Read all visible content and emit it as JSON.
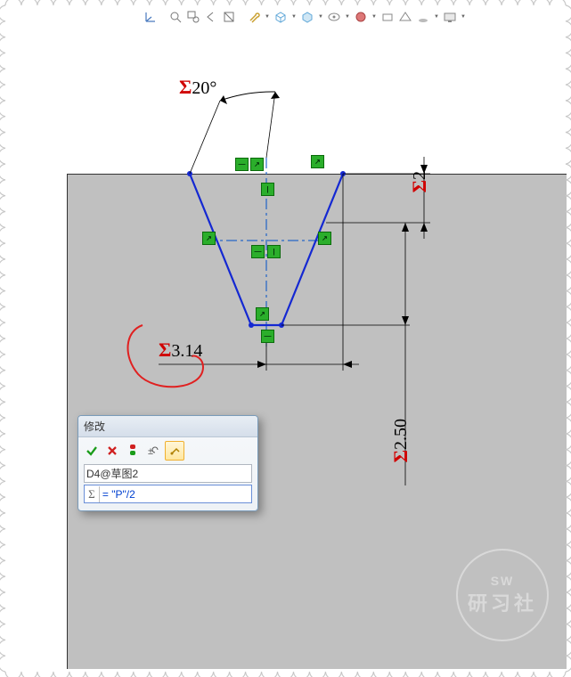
{
  "toolbar": {
    "items": [
      "origin",
      "zoom-fit",
      "zoom-area",
      "prev-view",
      "section",
      "guide",
      "orientation",
      "display",
      "hide",
      "color",
      "perspective",
      "shadow",
      "misc",
      "monitor"
    ]
  },
  "dimensions": {
    "angle": "20°",
    "bottom_width": "3.14",
    "right_height": "2.50",
    "right_top_gap": "2"
  },
  "dialog": {
    "title": "修改",
    "dim_name": "D4@草图2",
    "value": "= \"P\"/2"
  },
  "watermark": {
    "l1": "SW",
    "l2": "研习社"
  }
}
